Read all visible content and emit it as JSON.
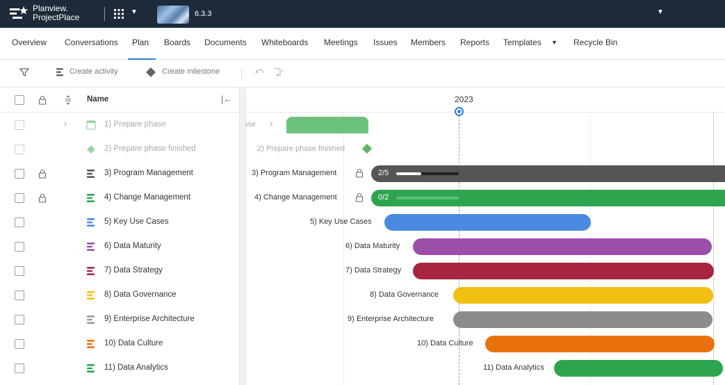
{
  "app": {
    "brand_line1": "Planview.",
    "brand_line2": "ProjectPlace",
    "version": "6.3.3"
  },
  "nav": {
    "tabs": [
      {
        "label": "Overview"
      },
      {
        "label": "Conversations"
      },
      {
        "label": "Plan",
        "active": true
      },
      {
        "label": "Boards"
      },
      {
        "label": "Documents"
      },
      {
        "label": "Whiteboards"
      },
      {
        "label": "Meetings"
      },
      {
        "label": "Issues"
      },
      {
        "label": "Members"
      },
      {
        "label": "Reports"
      },
      {
        "label": "Templates"
      },
      {
        "label": "Recycle Bin"
      }
    ]
  },
  "toolbar": {
    "create_activity": "Create activity",
    "create_milestone": "Create milestone"
  },
  "grid": {
    "name_header": "Name"
  },
  "gantt": {
    "year": "2023",
    "prepare_phase_label": "ase",
    "prepare_phase_finished_label": "2) Prepare phase finished",
    "program_mgmt_label": "3) Program Management",
    "program_mgmt_count": "2/5",
    "program_mgmt_progress": 0.4,
    "change_mgmt_label": "4) Change Management",
    "change_mgmt_count": "0/2",
    "change_mgmt_progress": 0.0
  },
  "rows": [
    {
      "name": "1) Prepare phase",
      "type": "phase",
      "color": "#6cc27a",
      "dim": true
    },
    {
      "name": "2) Prepare phase finished",
      "type": "milestone",
      "color": "#5cb85c",
      "dim": true
    },
    {
      "name": "3) Program Management",
      "type": "activity",
      "color": "#555555",
      "locked": true
    },
    {
      "name": "4) Change Management",
      "type": "activity",
      "color": "#2ea44f",
      "locked": true
    },
    {
      "name": "5) Key Use Cases",
      "type": "activity",
      "color": "#4a8ae0"
    },
    {
      "name": "6) Data Maturity",
      "type": "activity",
      "color": "#9c4fa8"
    },
    {
      "name": "7) Data Strategy",
      "type": "activity",
      "color": "#a7253f"
    },
    {
      "name": "8) Data Governance",
      "type": "activity",
      "color": "#f1c013"
    },
    {
      "name": "9) Enterprise Architecture",
      "type": "activity",
      "color": "#8c8c8c"
    },
    {
      "name": "10) Data Culture",
      "type": "activity",
      "color": "#e9720f"
    },
    {
      "name": "11) Data Analytics",
      "type": "activity",
      "color": "#2ea44f"
    }
  ]
}
